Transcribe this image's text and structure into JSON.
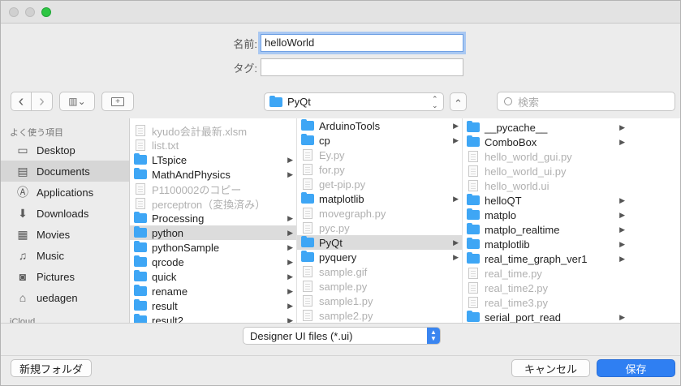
{
  "form": {
    "name_label": "名前:",
    "name_value": "helloWorld",
    "tag_label": "タグ:",
    "tag_value": ""
  },
  "toolbar": {
    "back": "‹",
    "forward": "›",
    "view_mode": "▥⌄",
    "new_folder_icon": "+",
    "location": "PyQt",
    "location_stepper": "⌃⌄",
    "expand": "⌃",
    "search_placeholder": "検索"
  },
  "sidebar": {
    "section_favorites": "よく使う項目",
    "section_icloud": "iCloud",
    "items": [
      {
        "label": "Desktop",
        "icon": "desktop-icon",
        "glyph": "▭"
      },
      {
        "label": "Documents",
        "icon": "documents-icon",
        "glyph": "▤",
        "selected": true
      },
      {
        "label": "Applications",
        "icon": "applications-icon",
        "glyph": "Ⓐ"
      },
      {
        "label": "Downloads",
        "icon": "downloads-icon",
        "glyph": "⬇"
      },
      {
        "label": "Movies",
        "icon": "movies-icon",
        "glyph": "▦"
      },
      {
        "label": "Music",
        "icon": "music-icon",
        "glyph": "♫"
      },
      {
        "label": "Pictures",
        "icon": "pictures-icon",
        "glyph": "◙"
      },
      {
        "label": "uedagen",
        "icon": "home-icon",
        "glyph": "⌂"
      }
    ]
  },
  "columns": [
    [
      {
        "label": "kyudo会計最新.xlsm",
        "kind": "file",
        "dim": true
      },
      {
        "label": "list.txt",
        "kind": "file",
        "dim": true
      },
      {
        "label": "LTspice",
        "kind": "folder",
        "arrow": true
      },
      {
        "label": "MathAndPhysics",
        "kind": "folder",
        "arrow": true
      },
      {
        "label": "P1100002のコピー",
        "kind": "file",
        "dim": true
      },
      {
        "label": "perceptron（変換済み）",
        "kind": "file",
        "dim": true
      },
      {
        "label": "Processing",
        "kind": "folder",
        "arrow": true
      },
      {
        "label": "python",
        "kind": "folder",
        "arrow": true,
        "selected": true
      },
      {
        "label": "pythonSample",
        "kind": "folder",
        "arrow": true
      },
      {
        "label": "qrcode",
        "kind": "folder",
        "arrow": true
      },
      {
        "label": "quick",
        "kind": "folder",
        "arrow": true
      },
      {
        "label": "rename",
        "kind": "folder",
        "arrow": true
      },
      {
        "label": "result",
        "kind": "folder",
        "arrow": true
      },
      {
        "label": "result2",
        "kind": "folder",
        "arrow": true
      }
    ],
    [
      {
        "label": "ArduinoTools",
        "kind": "folder",
        "arrow": true
      },
      {
        "label": "cp",
        "kind": "folder",
        "arrow": true
      },
      {
        "label": "Ey.py",
        "kind": "file",
        "dim": true
      },
      {
        "label": "for.py",
        "kind": "file",
        "dim": true
      },
      {
        "label": "get-pip.py",
        "kind": "file",
        "dim": true
      },
      {
        "label": "matplotlib",
        "kind": "folder",
        "arrow": true
      },
      {
        "label": "movegraph.py",
        "kind": "file",
        "dim": true
      },
      {
        "label": "pyc.py",
        "kind": "file",
        "dim": true
      },
      {
        "label": "PyQt",
        "kind": "folder",
        "arrow": true,
        "selected": true
      },
      {
        "label": "pyquery",
        "kind": "folder",
        "arrow": true
      },
      {
        "label": "sample.gif",
        "kind": "file",
        "dim": true
      },
      {
        "label": "sample.py",
        "kind": "file",
        "dim": true
      },
      {
        "label": "sample1.py",
        "kind": "file",
        "dim": true
      },
      {
        "label": "sample2.py",
        "kind": "file",
        "dim": true
      }
    ],
    [
      {
        "label": "__pycache__",
        "kind": "folder",
        "arrow": true
      },
      {
        "label": "ComboBox",
        "kind": "folder",
        "arrow": true
      },
      {
        "label": "hello_world_gui.py",
        "kind": "file",
        "dim": true
      },
      {
        "label": "hello_world_ui.py",
        "kind": "file",
        "dim": true
      },
      {
        "label": "hello_world.ui",
        "kind": "file",
        "dim": true
      },
      {
        "label": "helloQT",
        "kind": "folder",
        "arrow": true
      },
      {
        "label": "matplo",
        "kind": "folder",
        "arrow": true
      },
      {
        "label": "matplo_realtime",
        "kind": "folder",
        "arrow": true
      },
      {
        "label": "matplotlib",
        "kind": "folder",
        "arrow": true
      },
      {
        "label": "real_time_graph_ver1",
        "kind": "folder",
        "arrow": true
      },
      {
        "label": "real_time.py",
        "kind": "file",
        "dim": true
      },
      {
        "label": "real_time2.py",
        "kind": "file",
        "dim": true
      },
      {
        "label": "real_time3.py",
        "kind": "file",
        "dim": true
      },
      {
        "label": "serial_port_read",
        "kind": "folder",
        "arrow": true
      }
    ]
  ],
  "filter": {
    "value": "Designer UI files (*.ui)"
  },
  "buttons": {
    "new_folder": "新規フォルダ",
    "cancel": "キャンセル",
    "save": "保存"
  }
}
